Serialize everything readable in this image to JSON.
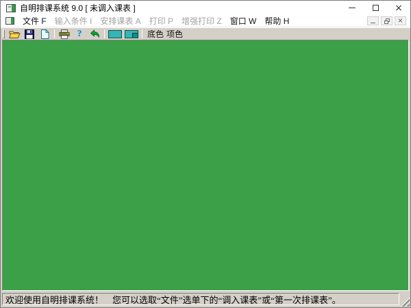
{
  "window": {
    "title": "自明排课系统 9.0 [ 未调入课表 ]",
    "border_color": "#7a7a7a"
  },
  "titlebar": {
    "icons": {
      "app": "app-window-icon",
      "minimize": "—",
      "maximize": "□",
      "close": "×"
    }
  },
  "menubar": {
    "items": [
      {
        "label": "文件 F",
        "enabled": true
      },
      {
        "label": "输入条件 I",
        "enabled": false
      },
      {
        "label": "安排课表 A",
        "enabled": false
      },
      {
        "label": "打印 P",
        "enabled": false
      },
      {
        "label": "增强打印 Z",
        "enabled": false
      },
      {
        "label": "窗口 W",
        "enabled": true
      },
      {
        "label": "帮助 H",
        "enabled": true
      }
    ],
    "mdi_icons": {
      "document": "mdi-child-document-icon",
      "minimize": "—",
      "restore": "❐",
      "close": "×"
    }
  },
  "toolbar": {
    "buttons": [
      {
        "name": "open",
        "icon": "open-folder-icon"
      },
      {
        "name": "save",
        "icon": "floppy-disk-icon"
      },
      {
        "name": "new",
        "icon": "blank-page-icon"
      },
      {
        "name": "print",
        "icon": "printer-icon"
      },
      {
        "name": "help",
        "icon": "question-mark-icon"
      },
      {
        "name": "undo",
        "icon": "undo-arrow-icon"
      }
    ],
    "help_glyph": "?",
    "swatches": [
      {
        "name": "background-color",
        "color": "#35b5b5"
      },
      {
        "name": "item-color",
        "color": "#35b5b5",
        "corner_color": "#0d8c8c"
      }
    ],
    "labels": {
      "bg": "底色",
      "item": "项色"
    }
  },
  "client_area": {
    "background_color": "#3ba047"
  },
  "statusbar": {
    "message": "欢迎使用自明排课系统！　您可以选取“文件”选单下的“调入课表”或“第一次排课表”。"
  }
}
